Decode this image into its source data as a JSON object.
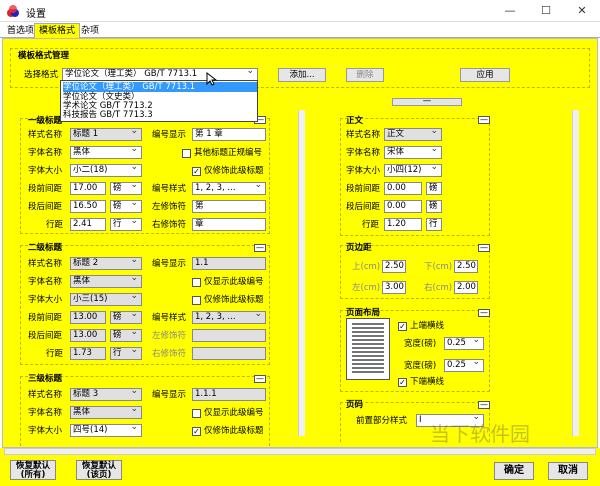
{
  "window": {
    "title": "设置",
    "minimize": "—",
    "maximize": "☐",
    "close": "✕"
  },
  "tabs": [
    "首选项",
    "模板格式",
    "杂项"
  ],
  "section_title": "模板格式管理",
  "template_select": {
    "label": "选择格式",
    "value": "学位论文（理工类） GB/T 7713.1",
    "options": [
      "学位论文（理工类） GB/T 7713.1",
      "学位论文（文史类）",
      "学术论文 GB/T 7713.2",
      "科技报告 GB/T 7713.3"
    ]
  },
  "buttons": {
    "add": "添加...",
    "delete": "删除",
    "apply": "应用",
    "ok": "确定",
    "cancel": "取消",
    "restore_all": [
      "恢复默认",
      "(所有)"
    ],
    "restore_page": [
      "恢复默认",
      "(该页)"
    ]
  },
  "level1": {
    "title": "一级标题",
    "style_label": "样式名称",
    "style": "标题 1",
    "num_label": "编号显示",
    "num": "第 1 章",
    "font_label": "字体名称",
    "font": "黑体",
    "other_label": "其他标题正规编号",
    "size_label": "字体大小",
    "size": "小二(18)",
    "modify_label": "仅修饰此级标题",
    "before_label": "段前间距",
    "before": "17.00",
    "before_unit": "磅",
    "numstyle_label": "编号样式",
    "numstyle": "1, 2, 3, ...",
    "after_label": "段后间距",
    "after": "16.50",
    "after_unit": "磅",
    "left_label": "左修饰符",
    "left": "第",
    "line_label": "行距",
    "line": "2.41",
    "line_unit": "行",
    "right_label": "右修饰符",
    "right": "章"
  },
  "level2": {
    "title": "二级标题",
    "style_label": "样式名称",
    "style": "标题 2",
    "num_label": "编号显示",
    "num": "1.1",
    "font_label": "字体名称",
    "font": "黑体",
    "show_label": "仅显示此级编号",
    "size_label": "字体大小",
    "size": "小三(15)",
    "modify_label": "仅修饰此级标题",
    "before_label": "段前间距",
    "before": "13.00",
    "before_unit": "磅",
    "numstyle_label": "编号样式",
    "numstyle": "1, 2, 3, ...",
    "after_label": "段后间距",
    "after": "13.00",
    "after_unit": "磅",
    "left_label": "左修饰符",
    "line_label": "行距",
    "line": "1.73",
    "line_unit": "行",
    "right_label": "右修饰符"
  },
  "level3": {
    "title": "三级标题",
    "style_label": "样式名称",
    "style": "标题 3",
    "num_label": "编号显示",
    "num": "1.1.1",
    "font_label": "字体名称",
    "font": "黑体",
    "show_label": "仅显示此级编号",
    "size_label": "字体大小",
    "size": "四号(14)",
    "modify_label": "仅修饰此级标题"
  },
  "body": {
    "title": "正文",
    "style_label": "样式名称",
    "style": "正文",
    "font_label": "字体名称",
    "font": "宋体",
    "size_label": "字体大小",
    "size": "小四(12)",
    "before_label": "段前间距",
    "before": "0.00",
    "before_unit": "磅",
    "after_label": "段后间距",
    "after": "0.00",
    "after_unit": "磅",
    "line_label": "行距",
    "line": "1.20",
    "line_unit": "行"
  },
  "margins": {
    "title": "页边距",
    "top_label": "上(cm)",
    "top": "2.50",
    "bottom_label": "下(cm)",
    "bottom": "2.50",
    "left_label": "左(cm)",
    "left": "3.00",
    "right_label": "右(cm)",
    "right": "2.00"
  },
  "layout": {
    "title": "页面布局",
    "upper_label": "上端横线",
    "weight_label": "宽度(磅)",
    "upper_weight": "0.25",
    "lower_weight": "0.25",
    "lower_label": "下端横线"
  },
  "page_num": {
    "title": "页码",
    "front_label": "前置部分样式",
    "front": "I"
  },
  "collapse_symbol": "—",
  "check_symbol": "✓",
  "watermark": "当下软件园",
  "colors": {
    "panel": "#ffff00",
    "selection": "#3399ff"
  }
}
